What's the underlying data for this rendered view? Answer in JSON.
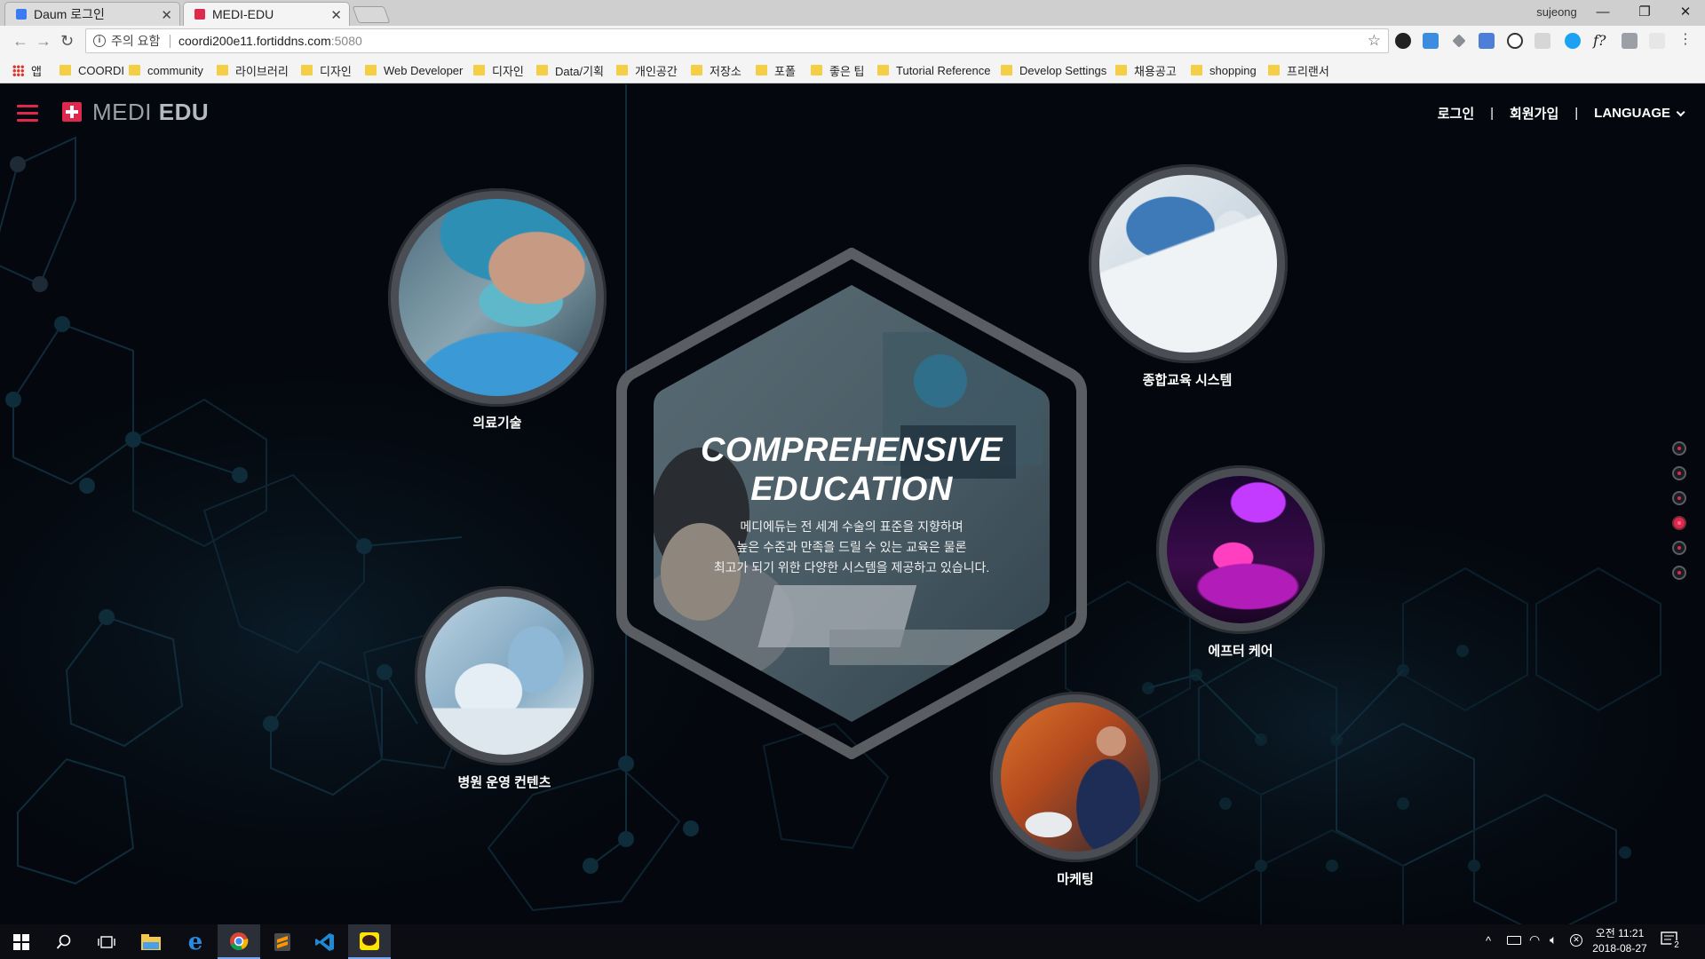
{
  "browser": {
    "tabs": [
      {
        "title": "Daum 로그인",
        "favicon_color": "#3b7cf4"
      },
      {
        "title": "MEDI-EDU",
        "favicon_color": "#e0284f"
      }
    ],
    "profile_name": "sujeong",
    "security_label": "주의 요함",
    "url_host": "coordi200e11.fortiddns.com",
    "url_port": ":5080",
    "bookmarks": [
      "앱",
      "COORDI",
      "community",
      "라이브러리",
      "디자인",
      "Web Developer",
      "디자인",
      "Data/기획",
      "개인공간",
      "저장소",
      "포폴",
      "좋은 팁",
      "Tutorial Reference",
      "Develop Settings",
      "채용공고",
      "shopping",
      "프리랜서"
    ]
  },
  "site": {
    "logo_light": "MEDI",
    "logo_bold": "EDU",
    "nav": {
      "login": "로그인",
      "signup": "회원가입",
      "language": "LANGUAGE",
      "divider": "|"
    },
    "hero": {
      "title_line1": "COMPREHENSIVE",
      "title_line2": "EDUCATION",
      "desc_line1": "메디에듀는 전 세계 수술의 표준을 지향하며",
      "desc_line2": "높은 수준과 만족을 드릴 수 있는 교육은 물론",
      "desc_line3": "최고가 되기 위한 다양한 시스템을 제공하고 있습니다."
    },
    "categories": [
      {
        "label": "의료기술",
        "icon": "surgeon-photo"
      },
      {
        "label": "종합교육 시스템",
        "icon": "tablet-photo"
      },
      {
        "label": "에프터 케어",
        "icon": "led-therapy-photo"
      },
      {
        "label": "병원 운영 컨텐츠",
        "icon": "hospital-monitor-photo"
      },
      {
        "label": "마케팅",
        "icon": "conference-photo"
      }
    ],
    "pager": {
      "count": 6,
      "active_index": 3
    },
    "accent_color": "#e0284f"
  },
  "taskbar": {
    "time": "오전 11:21",
    "date": "2018-08-27",
    "notification_count": "2"
  }
}
